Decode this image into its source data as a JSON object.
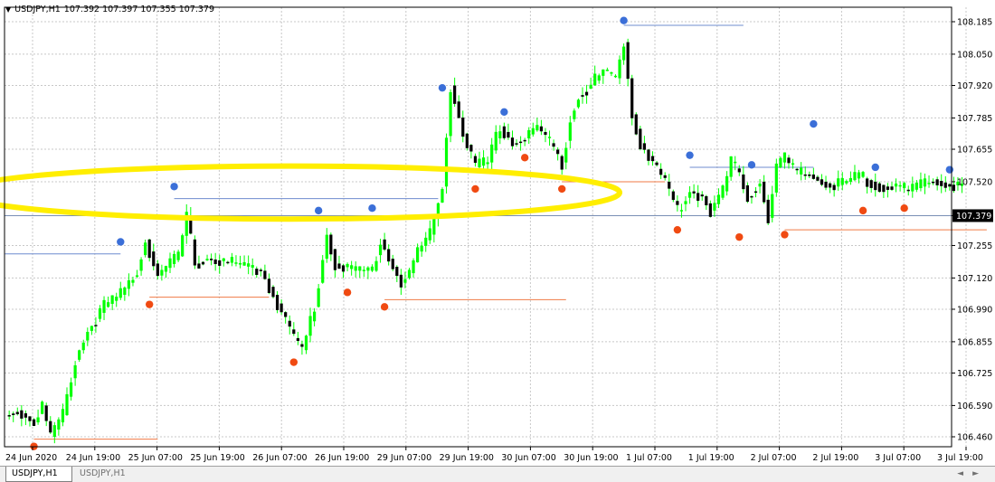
{
  "header": {
    "menu_icon": "triangle-down-icon",
    "symbol": "USDJPY,H1",
    "ohlc": "107.392 107.397 107.355 107.379"
  },
  "tabs": [
    {
      "label": "USDJPY,H1",
      "active": true
    },
    {
      "label": "USDJPY,H1",
      "active": false
    }
  ],
  "colors": {
    "candle": "#00ff00",
    "high_marker": "#3b6fd8",
    "low_marker": "#f04a12",
    "resistance_line": "#6f8ccf",
    "support_line": "#f07a45",
    "current_price_line": "#7a8fb5",
    "annotation_ellipse": "#ffee00"
  },
  "chart_data": {
    "type": "candlestick",
    "symbol": "USDJPY",
    "timeframe": "H1",
    "y_ticks": [
      "108.185",
      "108.050",
      "107.920",
      "107.785",
      "107.655",
      "107.520",
      "107.379",
      "107.255",
      "107.120",
      "106.990",
      "106.855",
      "106.725",
      "106.590",
      "106.460"
    ],
    "current_price": 107.379,
    "x_ticks": [
      "24 Jun 2020",
      "24 Jun 19:00",
      "25 Jun 07:00",
      "25 Jun 19:00",
      "26 Jun 07:00",
      "26 Jun 19:00",
      "29 Jun 07:00",
      "29 Jun 19:00",
      "30 Jun 07:00",
      "30 Jun 19:00",
      "1 Jul 07:00",
      "1 Jul 19:00",
      "2 Jul 07:00",
      "2 Jul 19:00",
      "3 Jul 07:00",
      "3 Jul 19:00"
    ],
    "price_path": [
      [
        0,
        106.55
      ],
      [
        3,
        106.57
      ],
      [
        7,
        106.52
      ],
      [
        9,
        106.59
      ],
      [
        11,
        106.46
      ],
      [
        14,
        106.55
      ],
      [
        17,
        106.78
      ],
      [
        20,
        106.9
      ],
      [
        24,
        107.0
      ],
      [
        28,
        107.05
      ],
      [
        32,
        107.15
      ],
      [
        34,
        107.28
      ],
      [
        37,
        107.13
      ],
      [
        42,
        107.21
      ],
      [
        44,
        107.38
      ],
      [
        46,
        107.18
      ],
      [
        49,
        107.2
      ],
      [
        55,
        107.18
      ],
      [
        62,
        107.15
      ],
      [
        65,
        107.05
      ],
      [
        70,
        106.87
      ],
      [
        72,
        106.82
      ],
      [
        75,
        107.0
      ],
      [
        78,
        107.3
      ],
      [
        80,
        107.18
      ],
      [
        84,
        107.15
      ],
      [
        89,
        107.15
      ],
      [
        91,
        107.28
      ],
      [
        93,
        107.2
      ],
      [
        96,
        107.1
      ],
      [
        98,
        107.14
      ],
      [
        100,
        107.23
      ],
      [
        103,
        107.3
      ],
      [
        106,
        107.5
      ],
      [
        108,
        107.92
      ],
      [
        111,
        107.72
      ],
      [
        114,
        107.58
      ],
      [
        117,
        107.6
      ],
      [
        120,
        107.75
      ],
      [
        123,
        107.68
      ],
      [
        126,
        107.7
      ],
      [
        129,
        107.75
      ],
      [
        132,
        107.68
      ],
      [
        135,
        107.6
      ],
      [
        137,
        107.78
      ],
      [
        139,
        107.88
      ],
      [
        142,
        107.92
      ],
      [
        145,
        107.98
      ],
      [
        148,
        107.95
      ],
      [
        150,
        108.1
      ],
      [
        152,
        107.8
      ],
      [
        154,
        107.68
      ],
      [
        157,
        107.6
      ],
      [
        160,
        107.52
      ],
      [
        163,
        107.4
      ],
      [
        166,
        107.48
      ],
      [
        169,
        107.46
      ],
      [
        171,
        107.4
      ],
      [
        174,
        107.48
      ],
      [
        176,
        107.6
      ],
      [
        178,
        107.55
      ],
      [
        180,
        107.46
      ],
      [
        183,
        107.52
      ],
      [
        185,
        107.37
      ],
      [
        187,
        107.58
      ],
      [
        189,
        107.62
      ],
      [
        192,
        107.55
      ],
      [
        195,
        107.55
      ],
      [
        198,
        107.52
      ],
      [
        201,
        107.5
      ],
      [
        204,
        107.52
      ],
      [
        207,
        107.54
      ],
      [
        210,
        107.52
      ],
      [
        213,
        107.5
      ],
      [
        216,
        107.5
      ],
      [
        219,
        107.48
      ],
      [
        222,
        107.5
      ],
      [
        225,
        107.53
      ],
      [
        228,
        107.51
      ],
      [
        232,
        107.5
      ]
    ],
    "swing_highs": [
      [
        28,
        107.27
      ],
      [
        41,
        107.5
      ],
      [
        76,
        107.4
      ],
      [
        89,
        107.41
      ],
      [
        106,
        107.91
      ],
      [
        121,
        107.81
      ],
      [
        150,
        108.19
      ],
      [
        166,
        107.63
      ],
      [
        181,
        107.59
      ],
      [
        196,
        107.76
      ],
      [
        211,
        107.58
      ],
      [
        229,
        107.57
      ]
    ],
    "swing_lows": [
      [
        7,
        106.42
      ],
      [
        35,
        107.01
      ],
      [
        70,
        106.77
      ],
      [
        83,
        107.06
      ],
      [
        92,
        107.0
      ],
      [
        114,
        107.49
      ],
      [
        126,
        107.62
      ],
      [
        135,
        107.49
      ],
      [
        163,
        107.32
      ],
      [
        178,
        107.29
      ],
      [
        189,
        107.3
      ],
      [
        208,
        107.4
      ],
      [
        218,
        107.41
      ]
    ],
    "resistance_levels": [
      [
        0,
        28,
        107.22
      ],
      [
        41,
        105,
        107.45
      ],
      [
        150,
        179,
        108.17
      ],
      [
        166,
        196,
        107.58
      ]
    ],
    "support_levels": [
      [
        7,
        37,
        106.45
      ],
      [
        35,
        64,
        107.04
      ],
      [
        92,
        136,
        107.03
      ],
      [
        135,
        160,
        107.52
      ],
      [
        189,
        238,
        107.32
      ]
    ],
    "annotation_ellipse": {
      "center_index": 69,
      "center_price": 107.475,
      "half_width_bars": 80,
      "half_height_price": 0.11
    }
  }
}
